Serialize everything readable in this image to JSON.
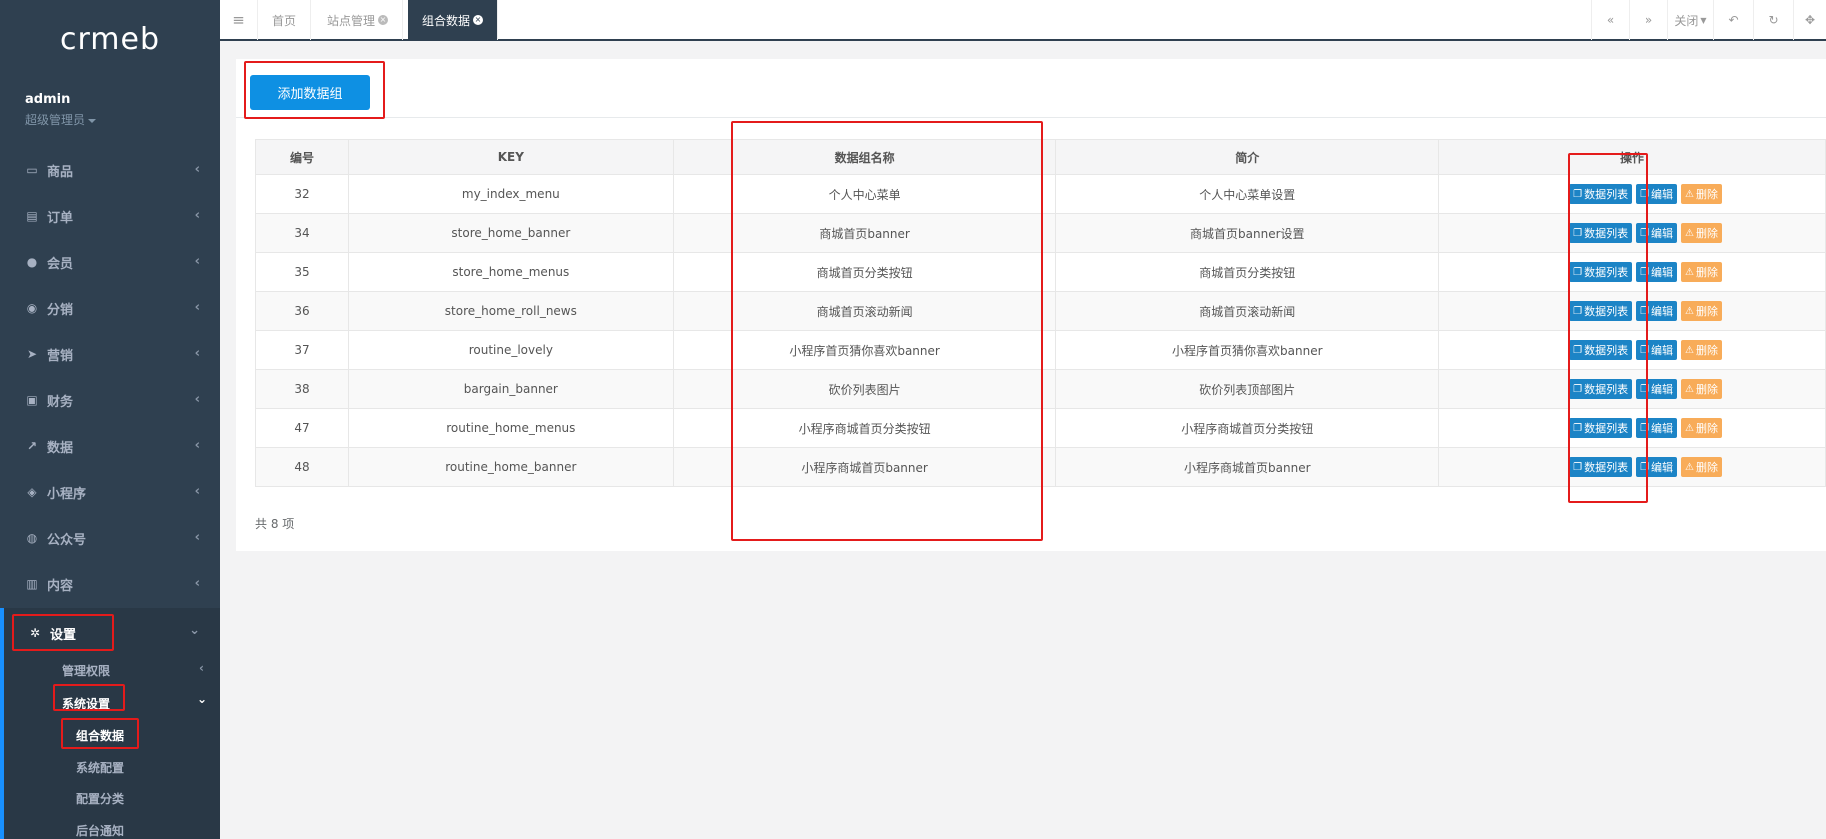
{
  "sidebar": {
    "logo": "crmeb",
    "user_name": "admin",
    "user_role": "超级管理员",
    "items": [
      {
        "label": "商品",
        "icon": "laptop-icon",
        "glyph": "▭"
      },
      {
        "label": "订单",
        "icon": "order-icon",
        "glyph": "▤"
      },
      {
        "label": "会员",
        "icon": "user-icon",
        "glyph": "●"
      },
      {
        "label": "分销",
        "icon": "users-icon",
        "glyph": "◉"
      },
      {
        "label": "营销",
        "icon": "paper-plane-icon",
        "glyph": "➤"
      },
      {
        "label": "财务",
        "icon": "money-icon",
        "glyph": "▣"
      },
      {
        "label": "数据",
        "icon": "chart-icon",
        "glyph": "↗"
      },
      {
        "label": "小程序",
        "icon": "cubes-icon",
        "glyph": "◈"
      },
      {
        "label": "公众号",
        "icon": "wechat-icon",
        "glyph": "◍"
      },
      {
        "label": "内容",
        "icon": "book-icon",
        "glyph": "▥"
      }
    ],
    "active_item": {
      "label": "设置",
      "icon": "gear-icon",
      "glyph": "✲"
    },
    "sub_items": {
      "perm": "管理权限",
      "system": "系统设置",
      "group_data": "组合数据",
      "sys_config": "系统配置",
      "config_cat": "配置分类",
      "notice": "后台通知"
    }
  },
  "tabs": {
    "home": "首页",
    "site": "站点管理",
    "current": "组合数据",
    "close_label": "关闭"
  },
  "toolbar": {
    "add_button": "添加数据组"
  },
  "table": {
    "headers": [
      "编号",
      "KEY",
      "数据组名称",
      "简介",
      "操作"
    ],
    "rows": [
      {
        "id": "32",
        "key": "my_index_menu",
        "name": "个人中心菜单",
        "desc": "个人中心菜单设置"
      },
      {
        "id": "34",
        "key": "store_home_banner",
        "name": "商城首页banner",
        "desc": "商城首页banner设置"
      },
      {
        "id": "35",
        "key": "store_home_menus",
        "name": "商城首页分类按钮",
        "desc": "商城首页分类按钮"
      },
      {
        "id": "36",
        "key": "store_home_roll_news",
        "name": "商城首页滚动新闻",
        "desc": "商城首页滚动新闻"
      },
      {
        "id": "37",
        "key": "routine_lovely",
        "name": "小程序首页猜你喜欢banner",
        "desc": "小程序首页猜你喜欢banner"
      },
      {
        "id": "38",
        "key": "bargain_banner",
        "name": "砍价列表图片",
        "desc": "砍价列表顶部图片"
      },
      {
        "id": "47",
        "key": "routine_home_menus",
        "name": "小程序商城首页分类按钮",
        "desc": "小程序商城首页分类按钮"
      },
      {
        "id": "48",
        "key": "routine_home_banner",
        "name": "小程序商城首页banner",
        "desc": "小程序商城首页banner"
      }
    ],
    "actions": {
      "list": "数据列表",
      "edit": "编辑",
      "delete": "删除"
    }
  },
  "footer": {
    "total": "共 8 项"
  },
  "colors": {
    "sidebar_bg": "#2f4050",
    "primary": "#0e90e3",
    "action_blue": "#1c84c6",
    "action_orange": "#f8ac59",
    "highlight_red": "#e41b1b"
  }
}
